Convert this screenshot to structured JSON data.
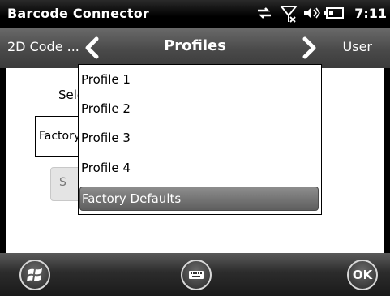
{
  "status_bar": {
    "app_title": "Barcode Connector",
    "time": "7:11",
    "icons": [
      "connectivity-icon",
      "no-signal-icon",
      "volume-icon",
      "battery-icon"
    ]
  },
  "nav_bar": {
    "left_label": "2D Code ...",
    "title": "Profiles",
    "right_label": "User"
  },
  "content": {
    "select_label": "Sele",
    "factory_field_text": "Factory",
    "ghost_button_text": "S"
  },
  "dropdown": {
    "options": [
      "Profile 1",
      "Profile 2",
      "Profile 3",
      "Profile 4",
      "Factory Defaults"
    ],
    "selected": "Factory Defaults"
  },
  "bottom_bar": {
    "ok_label": "OK"
  },
  "colors": {
    "selection_highlight": "#6f6f6f",
    "bar_background": "#000000"
  }
}
